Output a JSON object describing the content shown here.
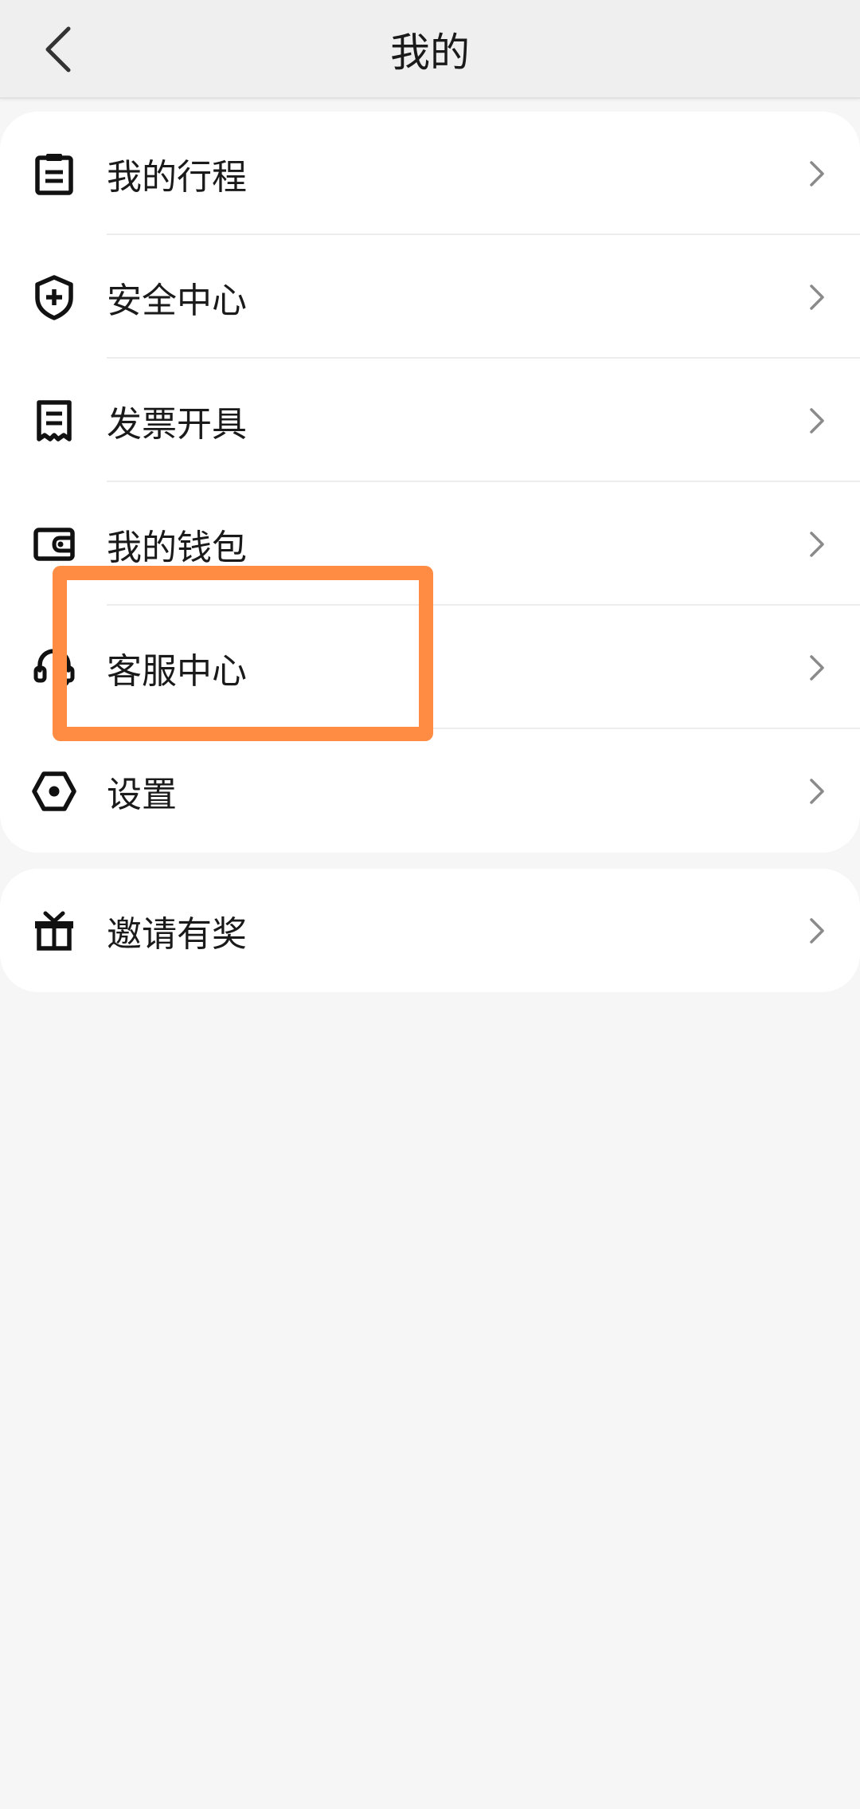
{
  "header": {
    "title": "我的",
    "back_icon": "chevron-left-icon"
  },
  "menu": {
    "items": [
      {
        "key": "trips",
        "label": "我的行程",
        "icon": "clipboard-icon"
      },
      {
        "key": "safety",
        "label": "安全中心",
        "icon": "shield-plus-icon"
      },
      {
        "key": "invoice",
        "label": "发票开具",
        "icon": "receipt-icon"
      },
      {
        "key": "wallet",
        "label": "我的钱包",
        "icon": "wallet-icon"
      },
      {
        "key": "service",
        "label": "客服中心",
        "icon": "headset-icon"
      },
      {
        "key": "settings",
        "label": "设置",
        "icon": "hex-nut-icon"
      }
    ]
  },
  "invite": {
    "label": "邀请有奖",
    "icon": "gift-icon"
  },
  "chevron_icon": "chevron-right-icon",
  "colors": {
    "background": "#f6f6f6",
    "card": "#ffffff",
    "highlight": "#ff8c42",
    "text": "#1a1a1a",
    "chevron": "#8a8a8a"
  }
}
